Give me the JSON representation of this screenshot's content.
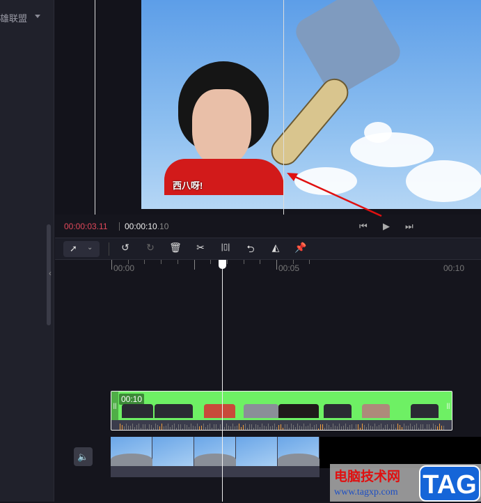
{
  "sidebar": {
    "item_label": "雄联盟"
  },
  "preview": {
    "sticker_caption": "西八呀!"
  },
  "playback": {
    "current_time": "00:00:03.11",
    "total_time_main": "00:00:10",
    "total_time_frac": ".10"
  },
  "toolbar": {
    "select_tool": "select-pointer",
    "tools": [
      "undo",
      "redo",
      "delete",
      "split",
      "freeze",
      "reverse",
      "mirror",
      "pin"
    ]
  },
  "ruler": {
    "labels": [
      "00:00",
      "00:05",
      "00:10"
    ]
  },
  "tracks": {
    "sticker_clip_duration": "00:10"
  },
  "watermark": {
    "cn": "电脑技术网",
    "url": "www.tagxp.com",
    "tag": "TAG"
  },
  "colors": {
    "accent_time": "#e0485a",
    "clip_green": "#6ef064"
  }
}
